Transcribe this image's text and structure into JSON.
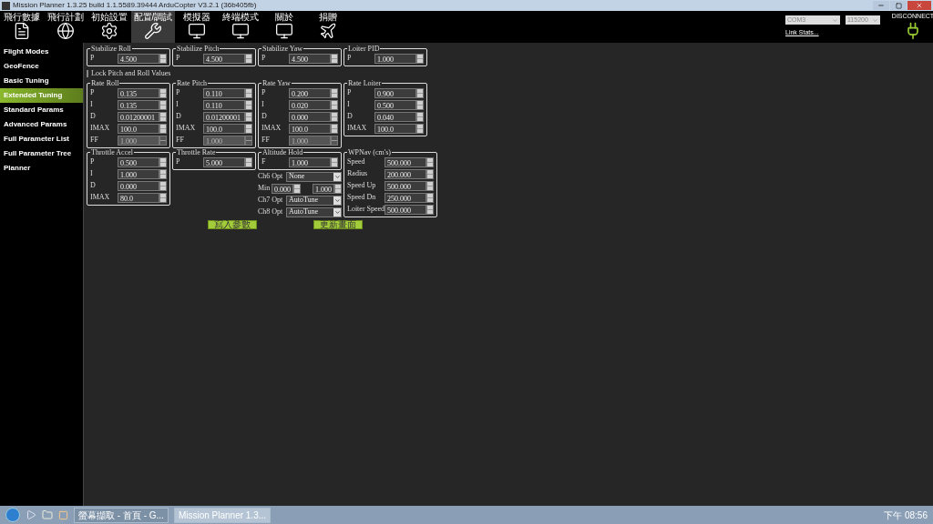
{
  "window": {
    "title": "Mission Planner 1.3.25 build 1.1.5589.39444 ArduCopter V3.2.1 (36b405fb)"
  },
  "toolbar": {
    "tabs": [
      {
        "label": "飛行數據",
        "selected": false
      },
      {
        "label": "飛行計劃",
        "selected": false
      },
      {
        "label": "初始設置",
        "selected": false
      },
      {
        "label": "配置/調試",
        "selected": true
      },
      {
        "label": "模擬器",
        "selected": false
      },
      {
        "label": "終端模式",
        "selected": false
      },
      {
        "label": "關於",
        "selected": false
      },
      {
        "label": "捐贈",
        "selected": false
      }
    ],
    "port": "COM3",
    "baud": "115200",
    "link_stats": "Link Stats...",
    "connect": "DISCONNECT"
  },
  "sidebar": {
    "items": [
      {
        "label": "Flight Modes",
        "selected": false
      },
      {
        "label": "GeoFence",
        "selected": false
      },
      {
        "label": "Basic Tuning",
        "selected": false
      },
      {
        "label": "Extended Tuning",
        "selected": true
      },
      {
        "label": "Standard Params",
        "selected": false
      },
      {
        "label": "Advanced Params",
        "selected": false
      },
      {
        "label": "Full Parameter List",
        "selected": false
      },
      {
        "label": "Full Parameter Tree",
        "selected": false
      },
      {
        "label": "Planner",
        "selected": false
      }
    ]
  },
  "rows": [
    [
      {
        "items": [
          {
            "kind": "group",
            "title": "Stabilize Roll",
            "params": [
              {
                "label": "P",
                "value": "4.500",
                "disabled": false
              }
            ]
          }
        ]
      },
      {
        "items": [
          {
            "kind": "group",
            "title": "Stabilize Pitch",
            "params": [
              {
                "label": "P",
                "value": "4.500",
                "disabled": false
              }
            ]
          }
        ]
      },
      {
        "items": [
          {
            "kind": "group",
            "title": "Stabilize Yaw",
            "params": [
              {
                "label": "P",
                "value": "4.500",
                "disabled": false
              }
            ]
          }
        ]
      },
      {
        "items": [
          {
            "kind": "group",
            "title": "Loiter PID",
            "params": [
              {
                "label": "P",
                "value": "1.000",
                "disabled": false
              }
            ]
          }
        ]
      }
    ],
    [
      {
        "items": [
          {
            "kind": "checkbox",
            "label": "Lock Pitch and Roll Values",
            "checked": false
          }
        ]
      }
    ],
    [
      {
        "items": [
          {
            "kind": "group",
            "title": "Rate Roll",
            "params": [
              {
                "label": "P",
                "value": "0.135",
                "disabled": false
              },
              {
                "label": "I",
                "value": "0.135",
                "disabled": false
              },
              {
                "label": "D",
                "value": "0.01200001",
                "disabled": false
              },
              {
                "label": "IMAX",
                "value": "100.0",
                "disabled": false
              },
              {
                "label": "FF",
                "value": "1.000",
                "disabled": true
              }
            ]
          }
        ]
      },
      {
        "items": [
          {
            "kind": "group",
            "title": "Rate Pitch",
            "params": [
              {
                "label": "P",
                "value": "0.110",
                "disabled": false
              },
              {
                "label": "I",
                "value": "0.110",
                "disabled": false
              },
              {
                "label": "D",
                "value": "0.01200001",
                "disabled": false
              },
              {
                "label": "IMAX",
                "value": "100.0",
                "disabled": false
              },
              {
                "label": "FF",
                "value": "1.000",
                "disabled": true
              }
            ]
          }
        ]
      },
      {
        "items": [
          {
            "kind": "group",
            "title": "Rate Yaw",
            "params": [
              {
                "label": "P",
                "value": "0.200",
                "disabled": false
              },
              {
                "label": "I",
                "value": "0.020",
                "disabled": false
              },
              {
                "label": "D",
                "value": "0.000",
                "disabled": false
              },
              {
                "label": "IMAX",
                "value": "100.0",
                "disabled": false
              },
              {
                "label": "FF",
                "value": "1.000",
                "disabled": true
              }
            ]
          }
        ]
      },
      {
        "items": [
          {
            "kind": "group",
            "title": "Rate Loiter",
            "params": [
              {
                "label": "P",
                "value": "0.900",
                "disabled": false
              },
              {
                "label": "I",
                "value": "0.500",
                "disabled": false
              },
              {
                "label": "D",
                "value": "0.040",
                "disabled": false
              },
              {
                "label": "IMAX",
                "value": "100.0",
                "disabled": false
              }
            ]
          }
        ]
      }
    ],
    [
      {
        "items": [
          {
            "kind": "group",
            "title": "Throttle Accel",
            "params": [
              {
                "label": "P",
                "value": "0.500",
                "disabled": false
              },
              {
                "label": "I",
                "value": "1.000",
                "disabled": false
              },
              {
                "label": "D",
                "value": "0.000",
                "disabled": false
              },
              {
                "label": "IMAX",
                "value": "80.0",
                "disabled": false
              }
            ]
          }
        ]
      },
      {
        "items": [
          {
            "kind": "group",
            "title": "Throttle Rate",
            "params": [
              {
                "label": "P",
                "value": "5.000",
                "disabled": false
              }
            ]
          }
        ]
      },
      {
        "items": [
          {
            "kind": "group",
            "title": "Altitude Hold",
            "params": [
              {
                "label": "F",
                "value": "1.000",
                "disabled": false
              }
            ]
          },
          {
            "kind": "select",
            "label": "Ch6 Opt",
            "value": "None"
          },
          {
            "kind": "range",
            "label": "Min",
            "low": "0.000",
            "high": "1.000"
          },
          {
            "kind": "select",
            "label": "Ch7 Opt",
            "value": "AutoTune"
          },
          {
            "kind": "select",
            "label": "Ch8 Opt",
            "value": "AutoTune"
          }
        ]
      },
      {
        "items": [
          {
            "kind": "group",
            "title": "WPNav (cm's)",
            "params": [
              {
                "label": "Speed",
                "value": "500.000",
                "disabled": false
              },
              {
                "label": "Radius",
                "value": "200.000",
                "disabled": false
              },
              {
                "label": "Speed Up",
                "value": "500.000",
                "disabled": false
              },
              {
                "label": "Speed Dn",
                "value": "250.000",
                "disabled": false
              },
              {
                "label": "Loiter Speed",
                "value": "500.000",
                "disabled": false
              }
            ]
          }
        ]
      }
    ]
  ],
  "buttons": [
    "寫入參數",
    "更新畫面"
  ],
  "taskbar": {
    "tasks": [
      {
        "label": "螢幕擷取 - 首頁 - G...",
        "selected": false
      },
      {
        "label": "Mission Planner 1.3...",
        "selected": true
      }
    ],
    "clock": "下午 08:56"
  }
}
